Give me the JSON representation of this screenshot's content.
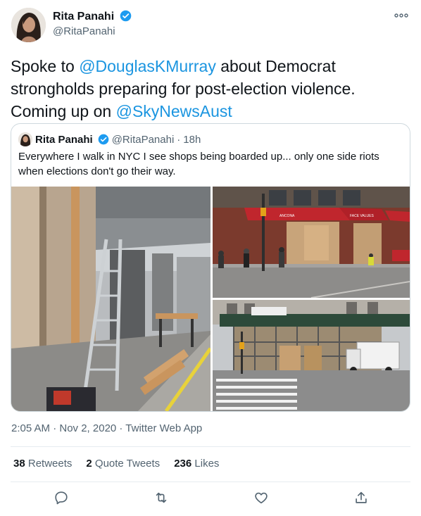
{
  "author": {
    "display_name": "Rita Panahi",
    "handle": "@RitaPanahi"
  },
  "tweet": {
    "text_1": "Spoke to ",
    "mention_1": "@DouglasKMurray",
    "text_2": " about Democrat strongholds preparing for post-election violence. Coming up on ",
    "mention_2": "@SkyNewsAust"
  },
  "quoted_tweet": {
    "display_name": "Rita Panahi",
    "handle": "@RitaPanahi",
    "separator": "·",
    "age": "18h",
    "text": "Everywhere I walk in NYC I see shops being boarded up... only one side riots when elections don't go their way.",
    "storefront_signs": [
      "ANCONA",
      "FACE VALUES"
    ]
  },
  "meta": {
    "timestamp": "2:05 AM · Nov 2, 2020 · Twitter Web App"
  },
  "stats": {
    "retweets_count": "38",
    "retweets_label": "Retweets",
    "quotes_count": "2",
    "quotes_label": "Quote Tweets",
    "likes_count": "236",
    "likes_label": "Likes"
  },
  "icons": {
    "verified": "verified-badge-icon",
    "more": "more-options-icon",
    "reply": "reply-icon",
    "retweet": "retweet-icon",
    "like": "like-icon",
    "share": "share-icon"
  },
  "colors": {
    "accent": "#1b95e0",
    "text_primary": "#0f1419",
    "text_secondary": "#536471",
    "border": "#cfd9de"
  }
}
